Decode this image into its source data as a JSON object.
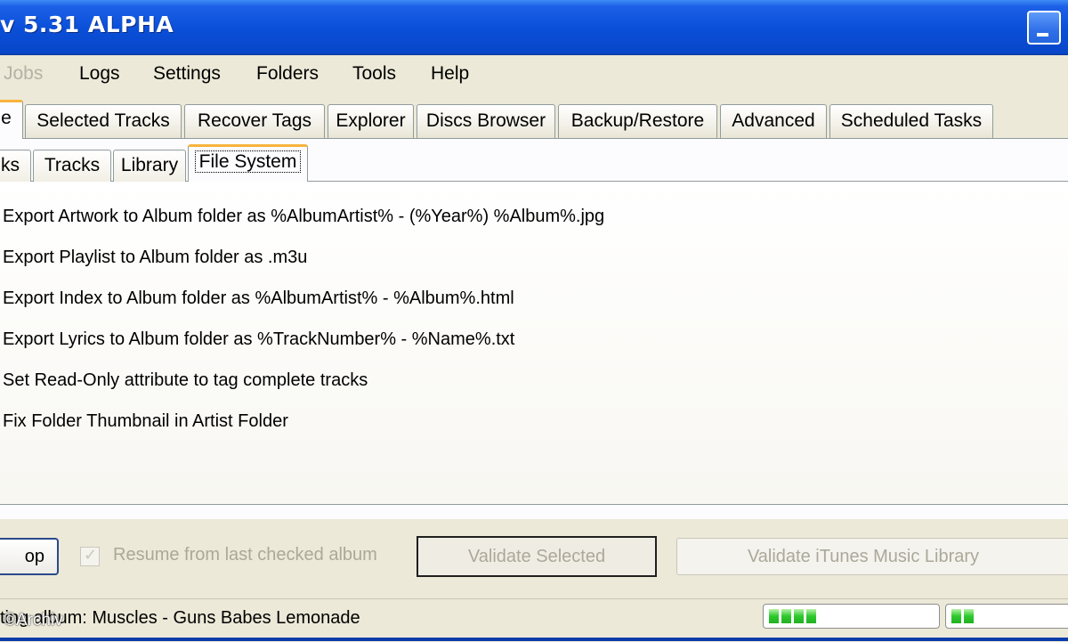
{
  "window": {
    "title": "v 5.31 ALPHA"
  },
  "menu": {
    "items": [
      "Jobs",
      "Logs",
      "Settings",
      "Folders",
      "Tools",
      "Help"
    ]
  },
  "main_tabs": [
    "e",
    "Selected Tracks",
    "Recover Tags",
    "Explorer",
    "Discs Browser",
    "Backup/Restore",
    "Advanced",
    "Scheduled Tasks"
  ],
  "main_tabs_active": "e",
  "sub_tabs": [
    "ks",
    "Tracks",
    "Library",
    "File System"
  ],
  "sub_tabs_active": "File System",
  "options": [
    "Export Artwork to Album folder as %AlbumArtist% - (%Year%) %Album%.jpg",
    "Export Playlist to Album folder as .m3u",
    "Export Index to Album folder as %AlbumArtist% - %Album%.html",
    "Export Lyrics to Album folder as %TrackNumber% - %Name%.txt",
    "Set Read-Only attribute to tag complete tracks",
    "Fix Folder Thumbnail in Artist Folder"
  ],
  "bottom": {
    "stop_label": "op",
    "resume_label": "Resume from last checked album",
    "resume_checked": true,
    "validate_selected_label": "Validate Selected",
    "validate_itunes_label": "Validate iTunes Music Library"
  },
  "status": {
    "text": "ting album: Muscles - Guns Babes Lemonade",
    "watermark": "©Archiv",
    "progress1_segments": 4,
    "progress2_segments": 2
  },
  "colors": {
    "titlebar": "#0A4FD8",
    "active_tab_accent": "#F8B33C",
    "progress_green": "#2DC92D"
  }
}
